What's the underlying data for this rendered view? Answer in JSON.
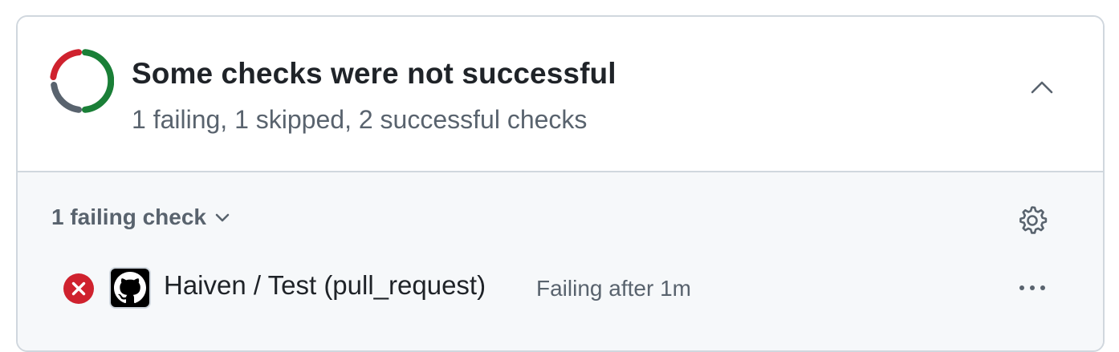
{
  "header": {
    "title": "Some checks were not successful",
    "subtitle": "1 failing, 1 skipped, 2 successful checks",
    "status_icon": "mixed-status-ring-icon",
    "collapse_icon": "chevron-up-icon"
  },
  "group": {
    "label": "1 failing check",
    "toggle_icon": "chevron-down-icon",
    "settings_icon": "gear-icon"
  },
  "checks": [
    {
      "name": "Haiven / Test (pull_request)",
      "status": "Failing after 1m",
      "state_icon": "x-circle-fill-icon",
      "app_icon": "github-mark-icon",
      "menu_icon": "kebab-horizontal-icon"
    }
  ],
  "colors": {
    "fail": "#cf222e",
    "success": "#1a7f37",
    "skipped": "#59636e",
    "border": "#d0d7de",
    "muted_bg": "#f6f8fa",
    "text": "#1f2328",
    "muted_text": "#59636e"
  }
}
